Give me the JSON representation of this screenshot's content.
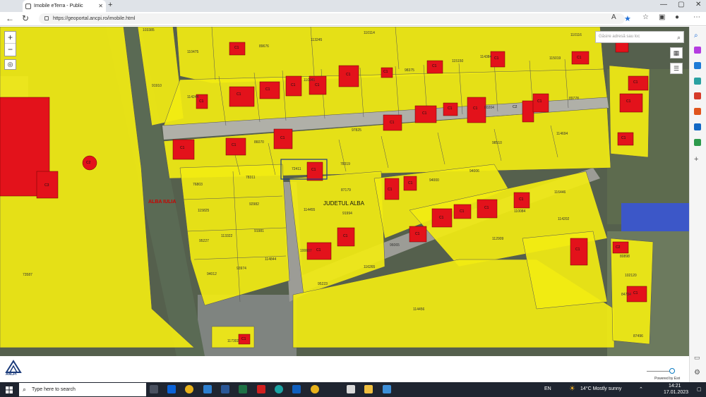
{
  "browser": {
    "tab_title": "Imobile eTerra - Public",
    "tab_close": "✕",
    "new_tab": "+",
    "url": "https://geoportal.ancpi.ro/imobile.html",
    "window_controls": [
      "—",
      "▢",
      "✕"
    ],
    "nav_icons": [
      "back-arrow-icon",
      "refresh-icon"
    ]
  },
  "map": {
    "search_placeholder": "Găsire adresă sau loc",
    "zoom_in": "+",
    "zoom_out": "−",
    "attribution": "Powered by Esri",
    "place_label": "ALBA IULIA",
    "county_label": "JUDETUL ALBA",
    "parcel_labels": [
      "103385",
      "110114",
      "110116",
      "110475",
      "89676",
      "113245",
      "115019",
      "91910",
      "114244",
      "110941",
      "98375",
      "115150",
      "114384",
      "97825",
      "86070",
      "80204",
      "89778",
      "114694",
      "98510",
      "72411",
      "78319",
      "78311",
      "76803",
      "94006",
      "94000",
      "87179",
      "114455",
      "91994",
      "116446",
      "115825",
      "92982",
      "113322",
      "91981",
      "95227",
      "114844",
      "114202",
      "112909",
      "100607",
      "96065",
      "94012",
      "93974",
      "116265",
      "95223",
      "114456",
      "73587",
      "80898",
      "102120",
      "84734",
      "87496",
      "117302",
      "110084"
    ],
    "building_labels": [
      "C1",
      "C2",
      "C3"
    ],
    "lens_icon": "⌕"
  },
  "footer": {
    "logo_text": "ANCPI"
  },
  "taskbar": {
    "search_text": "Type here to search",
    "language": "EN",
    "weather": "14°C  Mostly sunny",
    "time": "14:21",
    "date": "17.01.2023"
  },
  "colors": {
    "parcel": "#f2ec12",
    "building": "#e3121b",
    "imagery": "#4e5a48",
    "road": "#8a8f8a"
  }
}
